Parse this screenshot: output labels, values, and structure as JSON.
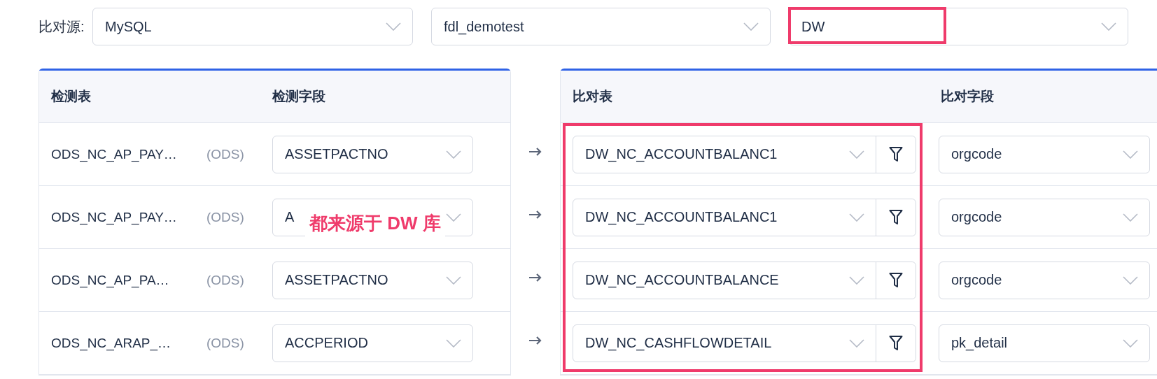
{
  "source": {
    "label": "比对源:",
    "selects": [
      {
        "value": "MySQL",
        "highlighted": false
      },
      {
        "value": "fdl_demotest",
        "highlighted": false
      },
      {
        "value": "DW",
        "highlighted": true
      }
    ]
  },
  "check_table": {
    "columns": [
      "检测表",
      "检测字段"
    ]
  },
  "compare_table": {
    "columns": [
      "比对表",
      "比对字段"
    ],
    "highlighted": true
  },
  "rows": [
    {
      "check_table": "ODS_NC_AP_PAY…",
      "schema": "(ODS)",
      "check_field": "ASSETPACTNO",
      "compare_table": "DW_NC_ACCOUNTBALANC1",
      "compare_field": "orgcode"
    },
    {
      "check_table": "ODS_NC_AP_PAY…",
      "schema": "(ODS)",
      "check_field": "A",
      "annotation": "都来源于 DW 库",
      "compare_table": "DW_NC_ACCOUNTBALANC1",
      "compare_field": "orgcode"
    },
    {
      "check_table": "ODS_NC_AP_PA…",
      "schema": "(ODS)",
      "check_field": "ASSETPACTNO",
      "compare_table": "DW_NC_ACCOUNTBALANCE",
      "compare_field": "orgcode"
    },
    {
      "check_table": "ODS_NC_ARAP_…",
      "schema": "(ODS)",
      "check_field": "ACCPERIOD",
      "compare_table": "DW_NC_CASHFLOWDETAIL",
      "compare_field": "pk_detail"
    }
  ]
}
